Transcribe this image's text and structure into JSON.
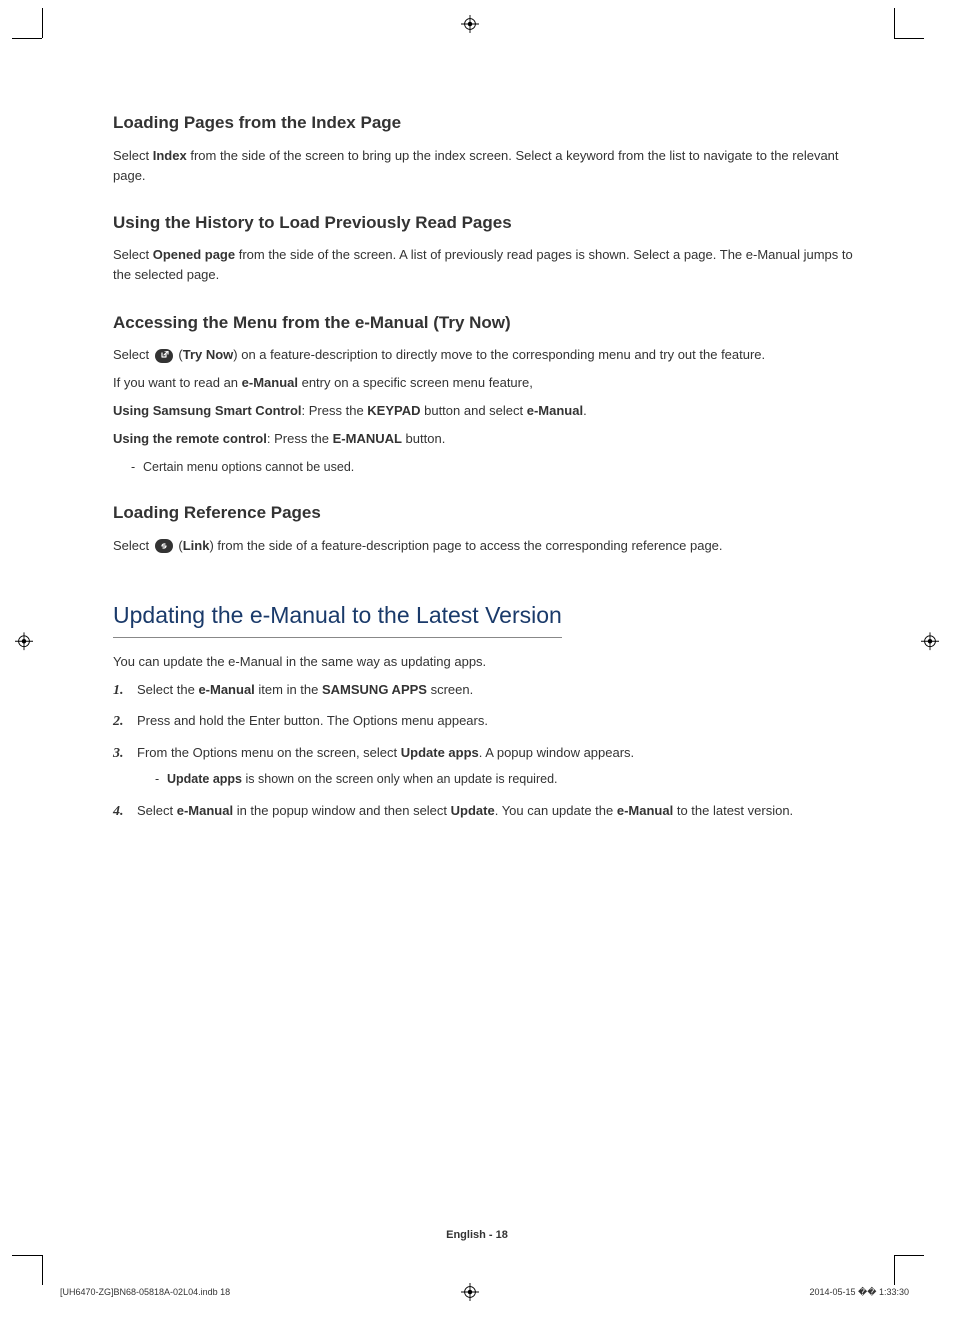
{
  "sections": {
    "s1": {
      "heading": "Loading Pages from the Index Page",
      "p1a": "Select ",
      "p1b": "Index",
      "p1c": " from the side of the screen to bring up the index screen. Select a keyword from the list to navigate to the relevant page."
    },
    "s2": {
      "heading": "Using the History to Load Previously Read Pages",
      "p1a": "Select ",
      "p1b": "Opened page",
      "p1c": " from the side of the screen. A list of previously read pages is shown. Select a page. The e-Manual jumps to the selected page."
    },
    "s3": {
      "heading": "Accessing the Menu from the e-Manual (Try Now)",
      "p1a": "Select ",
      "p1b": "(",
      "p1c": "Try Now",
      "p1d": ") on a feature-description to directly move to the corresponding menu and try out the feature.",
      "p2a": "If you want to read an ",
      "p2b": "e-Manual",
      "p2c": " entry on a specific screen menu feature,",
      "p3a": "Using Samsung Smart Control",
      "p3b": ": Press the ",
      "p3c": "KEYPAD",
      "p3d": " button and select ",
      "p3e": "e-Manual",
      "p3f": ".",
      "p4a": "Using the remote control",
      "p4b": ": Press the ",
      "p4c": "E-MANUAL",
      "p4d": " button.",
      "note": "Certain menu options cannot be used."
    },
    "s4": {
      "heading": "Loading Reference Pages",
      "p1a": "Select ",
      "p1b": "(",
      "p1c": "Link",
      "p1d": ") from the side of a feature-description page to access the corresponding reference page."
    }
  },
  "bigsection": {
    "heading": "Updating the e-Manual to the Latest Version",
    "intro": "You can update the e-Manual in the same way as updating apps.",
    "steps": {
      "s1a": "Select the ",
      "s1b": "e-Manual",
      "s1c": " item in the ",
      "s1d": "SAMSUNG APPS",
      "s1e": " screen.",
      "s2": "Press and hold the Enter button. The Options menu appears.",
      "s3a": "From the Options menu on the screen, select ",
      "s3b": "Update apps",
      "s3c": ". A popup window appears.",
      "s3note_a": "Update apps",
      "s3note_b": " is shown on the screen only when an update is required.",
      "s4a": "Select ",
      "s4b": "e-Manual",
      "s4c": " in the popup window and then select ",
      "s4d": "Update",
      "s4e": ". You can update the ",
      "s4f": "e-Manual",
      "s4g": " to the latest version."
    }
  },
  "footer": {
    "page": "English - 18",
    "file": "[UH6470-ZG]BN68-05818A-02L04.indb   18",
    "date": "2014-05-15   �� 1:33:30"
  }
}
